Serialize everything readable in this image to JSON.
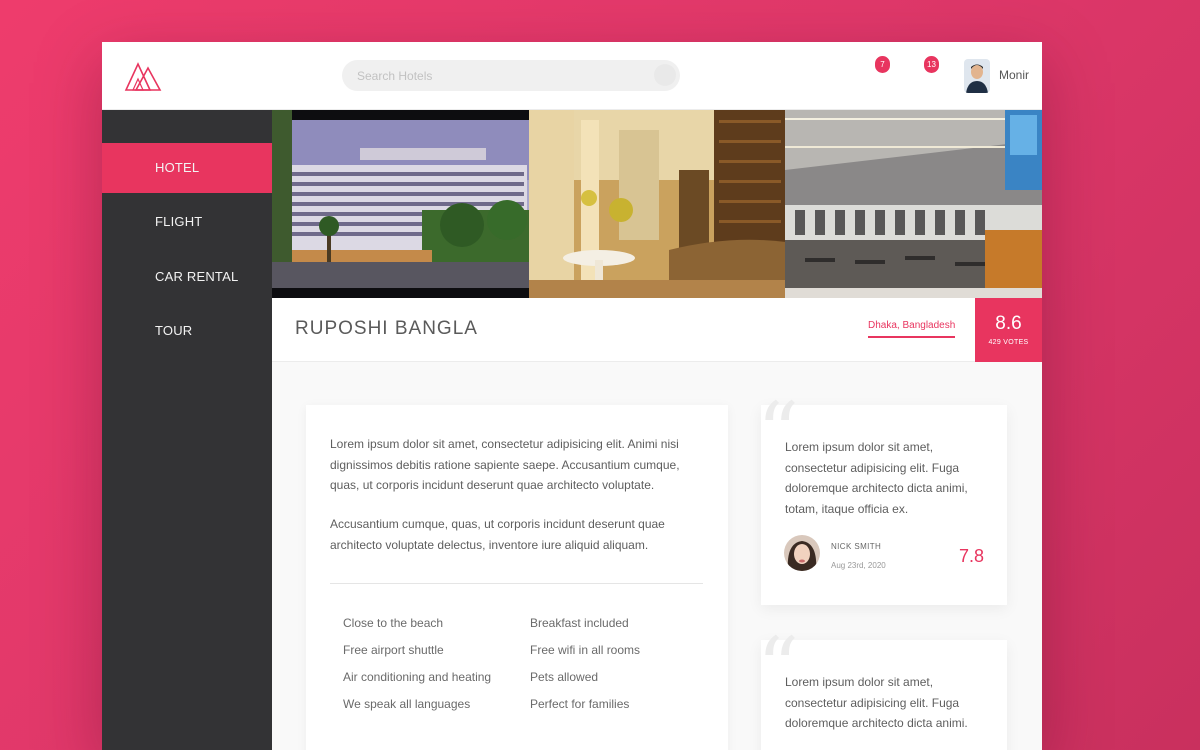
{
  "header": {
    "search_placeholder": "Search Hotels",
    "notifications": [
      {
        "icon": "notification-badge",
        "count": "7"
      },
      {
        "icon": "message-badge",
        "count": "13"
      }
    ],
    "user_name": "Monir",
    "logo_icon": "mountain-logo-icon"
  },
  "sidebar": {
    "items": [
      {
        "label": "HOTEL",
        "active": true
      },
      {
        "label": "FLIGHT",
        "active": false
      },
      {
        "label": "CAR RENTAL",
        "active": false
      },
      {
        "label": "TOUR",
        "active": false
      }
    ]
  },
  "hotel": {
    "name": "RUPOSHI BANGLA",
    "location": "Dhaka, Bangladesh",
    "score": "8.6",
    "votes": "429 VOTES",
    "description": [
      "Lorem ipsum dolor sit amet, consectetur adipisicing elit. Animi nisi dignissimos debitis ratione sapiente saepe. Accusantium cumque, quas, ut corporis incidunt deserunt quae architecto voluptate.",
      "Accusantium cumque, quas, ut corporis incidunt deserunt quae architecto voluptate delectus, inventore iure aliquid aliquam."
    ],
    "amenities": [
      "Close to the beach",
      "Breakfast included",
      "Free airport shuttle",
      "Free wifi in all rooms",
      "Air conditioning and heating",
      "Pets allowed",
      "We speak all languages",
      "Perfect for families"
    ]
  },
  "reviews": [
    {
      "text": "Lorem ipsum dolor sit amet, consectetur adipisicing elit. Fuga doloremque architecto dicta animi, totam, itaque officia ex.",
      "author": "NICK SMITH",
      "date": "Aug 23rd, 2020",
      "score": "7.8"
    },
    {
      "text": "Lorem ipsum dolor sit amet, consectetur adipisicing elit. Fuga doloremque architecto dicta animi."
    }
  ],
  "colors": {
    "accent": "#e8355f",
    "sidebar": "#333335"
  }
}
